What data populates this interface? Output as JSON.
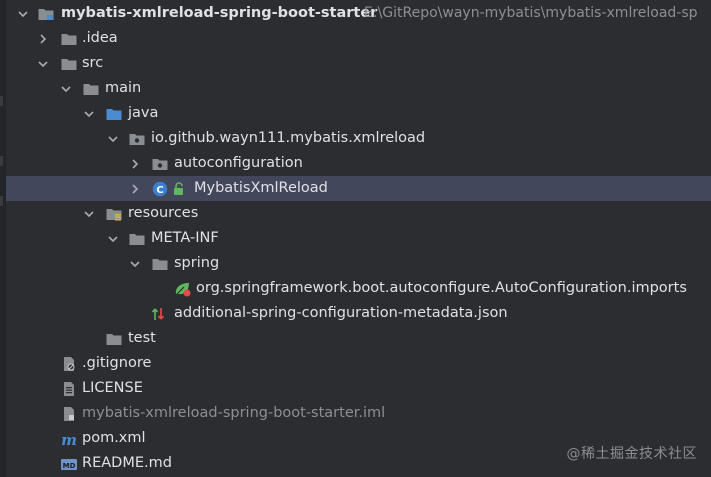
{
  "tree": {
    "root": {
      "name": "mybatis-xmlreload-spring-boot-starter",
      "path": "E:\\GitRepo\\wayn-mybatis\\mybatis-xmlreload-sp"
    },
    "idea": ".idea",
    "src": "src",
    "main": "main",
    "java": "java",
    "package": "io.github.wayn111.mybatis.xmlreload",
    "autoconfiguration": "autoconfiguration",
    "main_class": "MybatisXmlReload",
    "resources": "resources",
    "meta_inf": "META-INF",
    "spring": "spring",
    "imports_file": "org.springframework.boot.autoconfigure.AutoConfiguration.imports",
    "metadata_json": "additional-spring-configuration-metadata.json",
    "test": "test",
    "gitignore": ".gitignore",
    "license": "LICENSE",
    "iml": "mybatis-xmlreload-spring-boot-starter.iml",
    "pom": "pom.xml",
    "readme": "README.md"
  },
  "watermark": "@稀土掘金技术社区",
  "colors": {
    "background": "#2b2d30",
    "selection": "#43475c",
    "folder": "#8a8e93",
    "source_folder": "#4a8bd2",
    "class_icon": "#3b7fcf"
  }
}
